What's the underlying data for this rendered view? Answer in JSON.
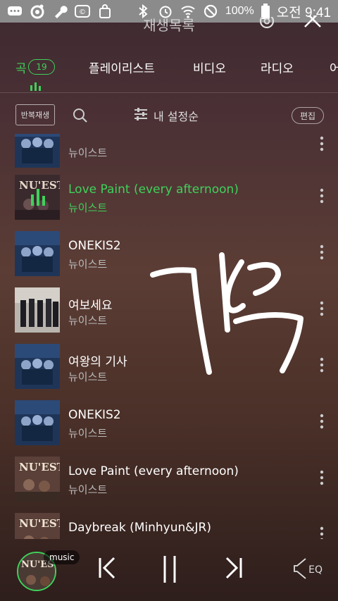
{
  "status_bar": {
    "battery": "100%",
    "time": "오전 9:41"
  },
  "header": {
    "title": "재생목록"
  },
  "tabs": [
    {
      "label": "곡",
      "count": "19",
      "active": true
    },
    {
      "label": "플레이리스트"
    },
    {
      "label": "비디오"
    },
    {
      "label": "라디오"
    },
    {
      "label": "어"
    }
  ],
  "toolbar": {
    "repeat_label": "반복재생",
    "sort_label": "내 설정순",
    "edit_label": "편집"
  },
  "songs": [
    {
      "title": "",
      "artist": "뉴이스트",
      "cover": "blue"
    },
    {
      "title": "Love Paint (every afternoon)",
      "artist": "뉴이스트",
      "cover": "nuest-playing",
      "playing": true
    },
    {
      "title": "ONEKIS2",
      "artist": "뉴이스트",
      "cover": "blue"
    },
    {
      "title": "여보세요",
      "artist": "뉴이스트",
      "cover": "group"
    },
    {
      "title": "여왕의 기사",
      "artist": "뉴이스트",
      "cover": "blue"
    },
    {
      "title": "ONEKIS2",
      "artist": "뉴이스트",
      "cover": "blue"
    },
    {
      "title": "Love Paint (every afternoon)",
      "artist": "뉴이스트",
      "cover": "nuest"
    },
    {
      "title": "Daybreak (Minhyun&JR)",
      "artist": "",
      "cover": "nuest"
    }
  ],
  "player": {
    "badge": "music",
    "eq_label": "EQ"
  },
  "colors": {
    "accent": "#3fd15a",
    "status_bar": "#8c8b8c"
  }
}
